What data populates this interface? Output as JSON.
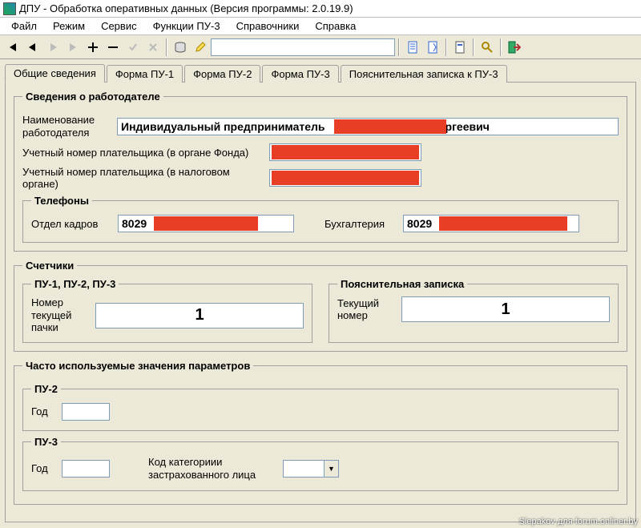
{
  "window": {
    "title": "ДПУ - Обработка оперативных данных (Версия программы: 2.0.19.9)"
  },
  "menu": {
    "file": "Файл",
    "mode": "Режим",
    "service": "Сервис",
    "functions": "Функции ПУ-3",
    "directories": "Справочники",
    "help": "Справка"
  },
  "tabs": {
    "general": "Общие сведения",
    "pu1": "Форма ПУ-1",
    "pu2": "Форма ПУ-2",
    "pu3": "Форма ПУ-3",
    "note": "Пояснительная записка к ПУ-3"
  },
  "employer": {
    "legend": "Сведения о работодателе",
    "name_label": "Наименование работодателя",
    "name_value_prefix": "Индивидуальный предприниматель ",
    "name_value_suffix": "ргеевич",
    "acct_fund_label": "Учетный номер плательщика (в органе Фонда)",
    "acct_tax_label": "Учетный номер плательщика (в налоговом органе)"
  },
  "phones": {
    "legend": "Телефоны",
    "hr_label": "Отдел кадров",
    "hr_prefix": "8029",
    "accounting_label": "Бухгалтерия",
    "accounting_prefix": "8029"
  },
  "counters": {
    "legend": "Счетчики",
    "pu_legend": "ПУ-1, ПУ-2, ПУ-3",
    "pu_label": "Номер текущей пачки",
    "pu_value": "1",
    "note_legend": "Пояснительная записка",
    "note_label": "Текущий номер",
    "note_value": "1"
  },
  "params": {
    "legend": "Часто используемые значения параметров",
    "pu2_legend": "ПУ-2",
    "pu2_year_label": "Год",
    "pu2_year_value": "",
    "pu3_legend": "ПУ-3",
    "pu3_year_label": "Год",
    "pu3_year_value": "",
    "pu3_category_label": "Код категориии застрахованного лица",
    "pu3_category_value": ""
  },
  "watermark": "Slepakov для forum.onliner.by"
}
